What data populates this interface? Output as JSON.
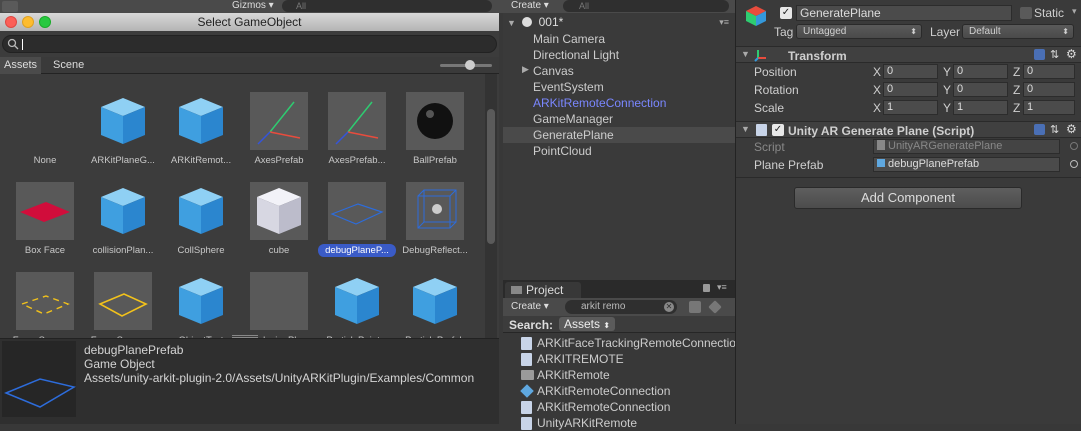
{
  "scene_toolbar": {
    "gizmos": "Gizmos",
    "search_placeholder": "All"
  },
  "hierarchy": {
    "create": "Create",
    "search_placeholder": "All",
    "scene_name": "001*",
    "items": [
      {
        "label": "Main Camera"
      },
      {
        "label": "Directional Light"
      },
      {
        "label": "Canvas"
      },
      {
        "label": "EventSystem"
      },
      {
        "label": "ARKitRemoteConnection"
      },
      {
        "label": "GameManager"
      },
      {
        "label": "GeneratePlane"
      },
      {
        "label": "PointCloud"
      }
    ]
  },
  "selector": {
    "title": "Select GameObject",
    "tabs": [
      "Assets",
      "Scene"
    ],
    "items": [
      {
        "label": "None",
        "thumb": "none"
      },
      {
        "label": "ARKitPlaneG...",
        "thumb": "cube"
      },
      {
        "label": "ARKitRemot...",
        "thumb": "cube"
      },
      {
        "label": "AxesPrefab",
        "thumb": "axes"
      },
      {
        "label": "AxesPrefab...",
        "thumb": "axes"
      },
      {
        "label": "BallPrefab",
        "thumb": "ball"
      },
      {
        "label": "Box Face",
        "thumb": "redplane"
      },
      {
        "label": "collisionPlan...",
        "thumb": "cube"
      },
      {
        "label": "CollSphere",
        "thumb": "cube"
      },
      {
        "label": "cube",
        "thumb": "whitecube"
      },
      {
        "label": "debugPlaneP...",
        "thumb": "blueplane",
        "selected": true
      },
      {
        "label": "DebugReflect...",
        "thumb": "wirecube"
      },
      {
        "label": "FocusSquare...",
        "thumb": "yellowdash"
      },
      {
        "label": "FocusSquare...",
        "thumb": "yellowplane"
      },
      {
        "label": "ObjectText",
        "thumb": "cube"
      },
      {
        "label": "occlusionPla...",
        "thumb": "empty"
      },
      {
        "label": "ParticlePaint...",
        "thumb": "cube"
      },
      {
        "label": "ParticlePrefab",
        "thumb": "cube"
      }
    ],
    "preview": {
      "name": "debugPlanePrefab",
      "type": "Game Object",
      "path": "Assets/unity-arkit-plugin-2.0/Assets/UnityARKitPlugin/Examples/Common"
    }
  },
  "project": {
    "tab": "Project",
    "create": "Create",
    "search_value": "arkit remo",
    "search_label": "Search:",
    "scope": "Assets",
    "items": [
      {
        "label": "ARKitFaceTrackingRemoteConnection",
        "icon": "script"
      },
      {
        "label": "ARKITREMOTE",
        "icon": "script"
      },
      {
        "label": "ARKitRemote",
        "icon": "folder"
      },
      {
        "label": "ARKitRemoteConnection",
        "icon": "prefab"
      },
      {
        "label": "ARKitRemoteConnection",
        "icon": "script"
      },
      {
        "label": "UnityARKitRemote",
        "icon": "script"
      }
    ]
  },
  "inspector": {
    "name": "GeneratePlane",
    "static_label": "Static",
    "tag_label": "Tag",
    "tag_value": "Untagged",
    "layer_label": "Layer",
    "layer_value": "Default",
    "transform": {
      "title": "Transform",
      "rows": [
        {
          "label": "Position",
          "x": "0",
          "y": "0",
          "z": "0"
        },
        {
          "label": "Rotation",
          "x": "0",
          "y": "0",
          "z": "0"
        },
        {
          "label": "Scale",
          "x": "1",
          "y": "1",
          "z": "1"
        }
      ],
      "axis": [
        "X",
        "Y",
        "Z"
      ]
    },
    "script": {
      "title": "Unity AR Generate Plane (Script)",
      "script_label": "Script",
      "script_value": "UnityARGeneratePlane",
      "prefab_label": "Plane Prefab",
      "prefab_value": "debugPlanePrefab"
    },
    "add_component": "Add Component"
  },
  "colors": {
    "selection_blue": "#3a5bc7",
    "prefab_text": "#7a87ff",
    "panel": "#383838"
  }
}
